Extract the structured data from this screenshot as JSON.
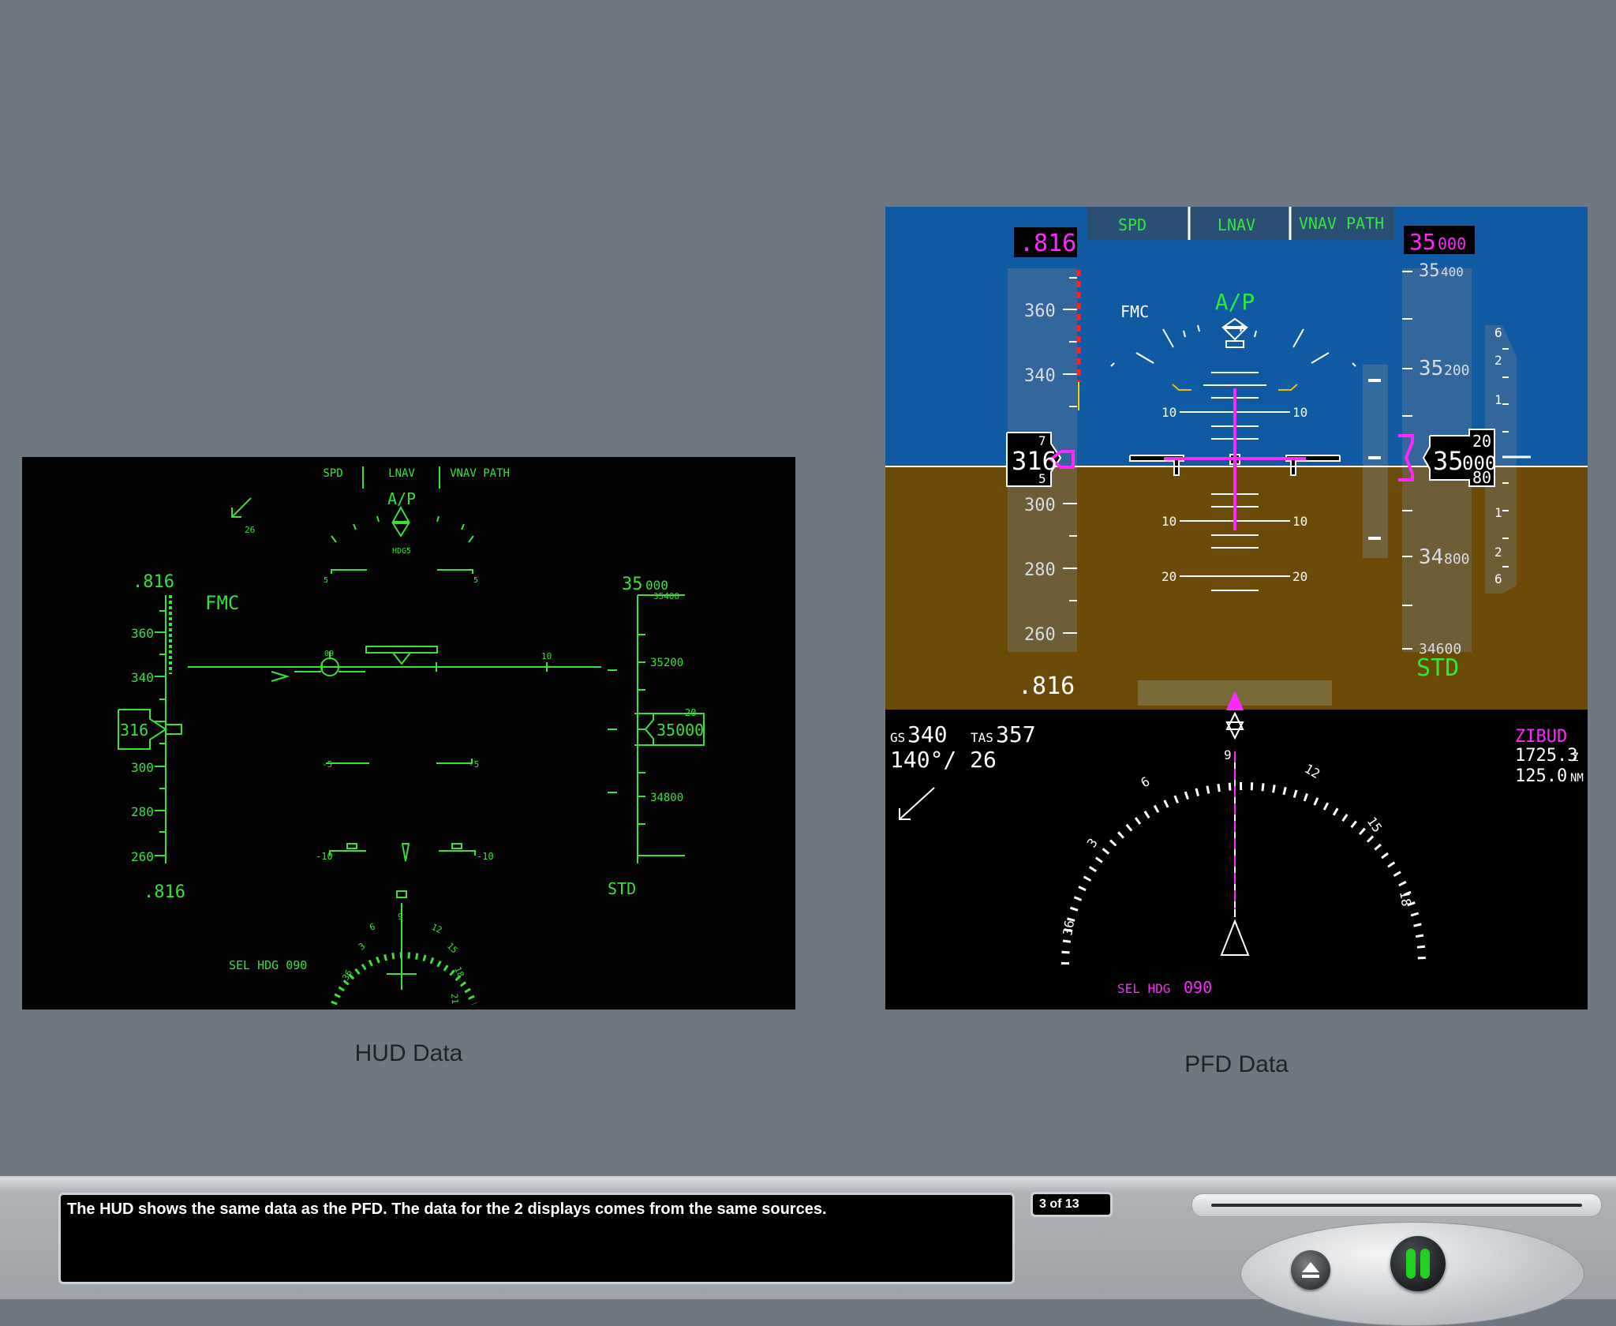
{
  "hud": {
    "modes": [
      "SPD",
      "LNAV",
      "VNAV PATH"
    ],
    "ap_status": "A/P",
    "ap_sub": "HDG5",
    "wind_speed": "26",
    "mach_top": ".816",
    "mach_bottom": ".816",
    "speed_source": "FMC",
    "speed_ticks": [
      "360",
      "340",
      "300",
      "280",
      "260"
    ],
    "speed_current": "316",
    "sel_alt_prefix": "35",
    "sel_alt_suffix": "000",
    "alt_ticks": [
      "35400",
      "35200",
      "34800"
    ],
    "alt_current": "35000",
    "alt_roll": "20",
    "baro": "STD",
    "horizon_label_1": "09",
    "horizon_label_2": "10",
    "pitch_5_pos": "5",
    "pitch_5_neg": "-5",
    "pitch_10_neg": "-10",
    "sel_hdg": "SEL HDG 090",
    "compass_labels": [
      "36",
      "3",
      "6",
      "9",
      "12",
      "15",
      "18",
      "21"
    ]
  },
  "pfd": {
    "modes": [
      "SPD",
      "LNAV",
      "VNAV PATH"
    ],
    "mach_top": ".816",
    "mach_bottom": ".816",
    "sel_alt_prefix": "35",
    "sel_alt_suffix": "000",
    "speed_source": "FMC",
    "ap_status": "A/P",
    "speed_ticks": [
      "360",
      "340",
      "300",
      "280",
      "260"
    ],
    "speed_current": "316",
    "speed_roll_up": "7",
    "speed_roll_down": "5",
    "alt_ticks": [
      {
        "big": "35",
        "small": "400"
      },
      {
        "big": "35",
        "small": "200"
      },
      {
        "big": "34",
        "small": "800"
      }
    ],
    "alt_bottom_partial": "34600",
    "alt_current_big": "35",
    "alt_current_small": "000",
    "alt_roll_up": "20",
    "alt_roll_down": "80",
    "baro": "STD",
    "pitch_labels": [
      "10",
      "10",
      "10",
      "10",
      "20",
      "20"
    ],
    "vsi_labels": [
      "6",
      "2",
      "1",
      "1",
      "2",
      "6"
    ],
    "gs_label": "GS",
    "gs_value": "340",
    "tas_label": "TAS",
    "tas_value": "357",
    "wind": "140°/ 26",
    "waypoint": "ZIBUD",
    "eta": "1725.3",
    "eta_unit": "Z",
    "distance": "125.0",
    "distance_unit": "NM",
    "sel_hdg_label": "SEL HDG",
    "sel_hdg_value": "090",
    "compass_labels": [
      "36",
      "3",
      "6",
      "9",
      "12",
      "15",
      "18"
    ]
  },
  "captions": {
    "hud": "HUD Data",
    "pfd": "PFD Data"
  },
  "player": {
    "narration": "The HUD shows the same data as the PFD. The data for the 2 displays comes from the same sources.",
    "page": "3 of 13"
  },
  "colors": {
    "hud_green": "#39e03a",
    "sky": "#0f5aa3",
    "ground": "#6b4a08",
    "magenta": "#ff29ff",
    "pfd_green": "#2ee83a"
  }
}
